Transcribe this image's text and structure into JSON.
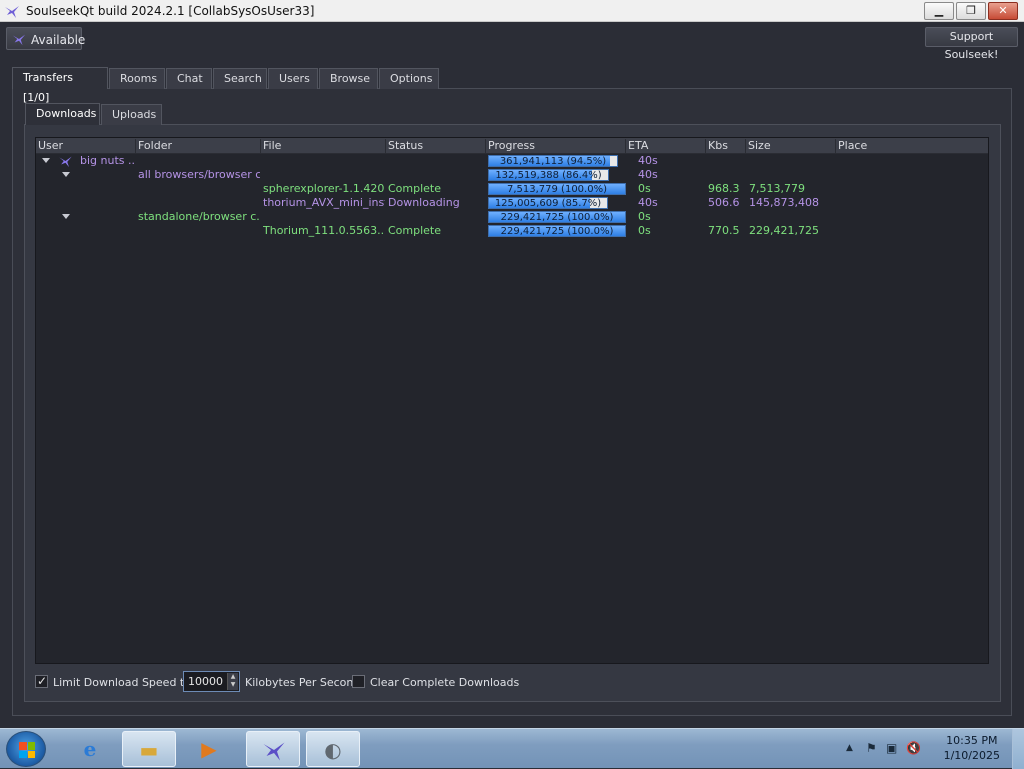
{
  "window": {
    "title": "SoulseekQt build 2024.2.1 [CollabSysOsUser33]",
    "minimize_glyph": "▁",
    "maximize_glyph": "❐",
    "close_glyph": "✕"
  },
  "toolbar": {
    "status_label": "Available",
    "support_label": "Support Soulseek!"
  },
  "main_tabs": [
    {
      "label": "Transfers [1/0]",
      "active": true
    },
    {
      "label": "Rooms"
    },
    {
      "label": "Chat"
    },
    {
      "label": "Search"
    },
    {
      "label": "Users"
    },
    {
      "label": "Browse"
    },
    {
      "label": "Options"
    }
  ],
  "sub_tabs": [
    {
      "label": "Downloads",
      "active": true
    },
    {
      "label": "Uploads"
    }
  ],
  "table": {
    "columns": [
      "User",
      "Folder",
      "File",
      "Status",
      "Progress",
      "ETA",
      "Kbs",
      "Size",
      "Place"
    ],
    "rows": [
      {
        "user": "big nuts ...",
        "folder": "",
        "file": "",
        "status": "",
        "progress_text": "361,941,113 (94.5%)",
        "progress": 0.945,
        "eta": "40s",
        "kbs": "",
        "size": "",
        "color": "purple"
      },
      {
        "user": "",
        "folder": "all browsers/browser c...",
        "file": "",
        "status": "",
        "progress_text": "132,519,388 (86.4%)",
        "progress": 0.864,
        "eta": "40s",
        "kbs": "",
        "size": "",
        "color": "purple"
      },
      {
        "user": "",
        "folder": "",
        "file": "spherexplorer-1.1.420...",
        "status": "Complete",
        "progress_text": "7,513,779 (100.0%)",
        "progress": 1.0,
        "eta": "0s",
        "kbs": "968.3",
        "size": "7,513,779",
        "color": "green"
      },
      {
        "user": "",
        "folder": "",
        "file": "thorium_AVX_mini_inst...",
        "status": "Downloading",
        "progress_text": "125,005,609 (85.7%)",
        "progress": 0.857,
        "eta": "40s",
        "kbs": "506.6",
        "size": "145,873,408",
        "color": "purple"
      },
      {
        "user": "",
        "folder": "standalone/browser c...",
        "file": "",
        "status": "",
        "progress_text": "229,421,725 (100.0%)",
        "progress": 1.0,
        "eta": "0s",
        "kbs": "",
        "size": "",
        "color": "green"
      },
      {
        "user": "",
        "folder": "",
        "file": "Thorium_111.0.5563....",
        "status": "Complete",
        "progress_text": "229,421,725 (100.0%)",
        "progress": 1.0,
        "eta": "0s",
        "kbs": "770.5",
        "size": "229,421,725",
        "color": "green"
      }
    ]
  },
  "bottom": {
    "limit_checked": true,
    "limit_label": "Limit Download Speed to",
    "speed_value": "10000",
    "unit_label": "Kilobytes Per Second",
    "clear_checked": false,
    "clear_label": "Clear Complete Downloads"
  },
  "taskbar": {
    "apps": [
      "internet-explorer-icon",
      "file-explorer-icon",
      "media-player-icon",
      "soulseek-icon",
      "disc-app-icon"
    ],
    "time": "10:35 PM",
    "date": "1/10/2025"
  },
  "colors": {
    "purple_text": "#b593e6",
    "green_text": "#7ee07e",
    "progress_fill": "#2e7fe4"
  }
}
